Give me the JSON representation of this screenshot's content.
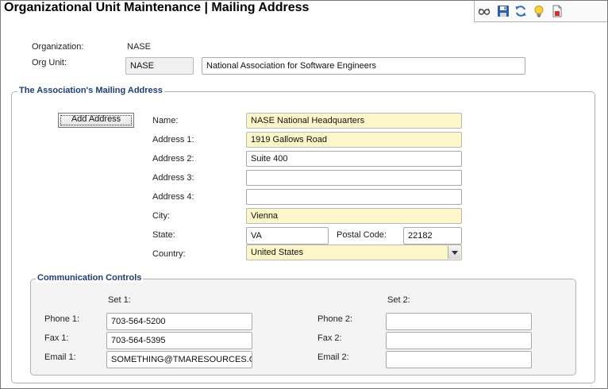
{
  "page": {
    "title": "Organizational Unit Maintenance | Mailing Address"
  },
  "toolbar": {
    "icons": [
      "glasses-icon",
      "save-icon",
      "refresh-icon",
      "lightbulb-icon",
      "report-icon"
    ]
  },
  "header": {
    "organization_label": "Organization:",
    "organization_value": "NASE",
    "org_unit_label": "Org Unit:",
    "org_unit_code": "NASE",
    "org_unit_name": "National Association for Software Engineers"
  },
  "mailing": {
    "group_title": "The Association's Mailing Address",
    "add_address_label": "Add Address",
    "labels": {
      "name": "Name:",
      "address1": "Address 1:",
      "address2": "Address 2:",
      "address3": "Address 3:",
      "address4": "Address 4:",
      "city": "City:",
      "state": "State:",
      "postal": "Postal Code:",
      "country": "Country:"
    },
    "values": {
      "name": "NASE National Headquarters",
      "address1": "1919 Gallows Road",
      "address2": "Suite 400",
      "address3": "",
      "address4": "",
      "city": "Vienna",
      "state": "VA",
      "postal": "22182",
      "country": "United States"
    }
  },
  "comm": {
    "group_title": "Communication Controls",
    "set1_label": "Set 1:",
    "set2_label": "Set 2:",
    "labels": {
      "phone1": "Phone 1:",
      "fax1": "Fax 1:",
      "email1": "Email 1:",
      "phone2": "Phone 2:",
      "fax2": "Fax 2:",
      "email2": "Email 2:"
    },
    "values": {
      "phone1": "703-564-5200",
      "fax1": "703-564-5395",
      "email1": "SOMETHING@TMARESOURCES.CO",
      "phone2": "",
      "fax2": "",
      "email2": ""
    }
  },
  "colors": {
    "required_field": "#fdf6c8",
    "group_title": "#1f3d78",
    "readonly_field": "#f0f0f0"
  }
}
